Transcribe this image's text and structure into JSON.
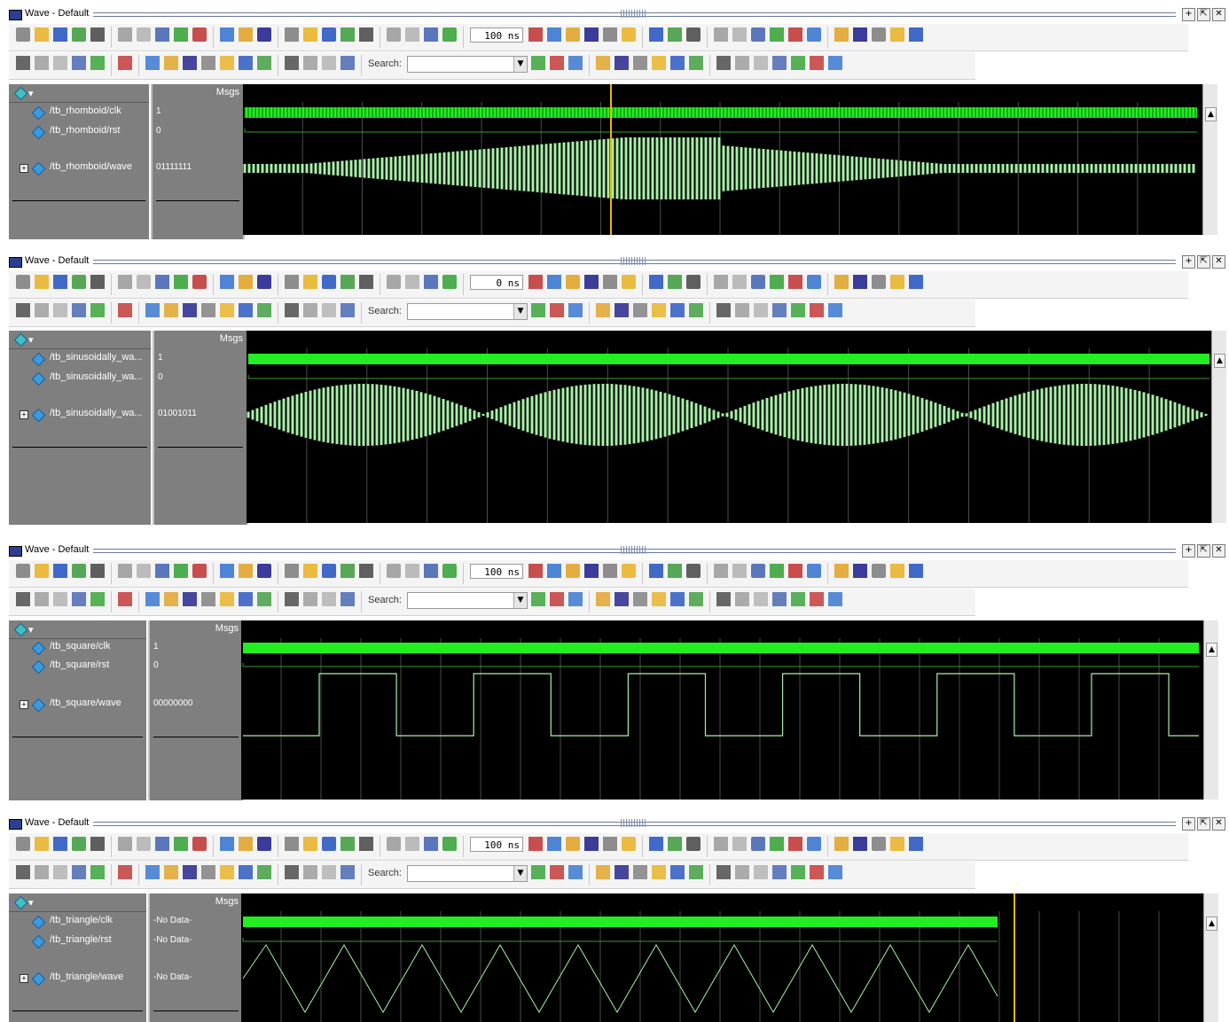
{
  "colors": {
    "wave_green": "#a8f0a8",
    "clk_green": "#22ee22",
    "cursor_yellow": "#f0b400",
    "grid": "#4a4a4a",
    "name_bg": "#7f7f7f"
  },
  "panels": [
    {
      "window_title": "Wave - Default",
      "time_value": "100 ns",
      "search_label": "Search:",
      "msgs_header": "Msgs",
      "signals": [
        {
          "name": "/tb_rhomboid/clk",
          "value": "1",
          "expandable": false
        },
        {
          "name": "/tb_rhomboid/rst",
          "value": "0",
          "expandable": false
        },
        {
          "name": "/tb_rhomboid/wave",
          "value": "01111111",
          "expandable": true
        }
      ],
      "wave_shape": "rhomboid",
      "has_cursor": true
    },
    {
      "window_title": "Wave - Default",
      "time_value": "0 ns",
      "search_label": "Search:",
      "msgs_header": "Msgs",
      "signals": [
        {
          "name": "/tb_sinusoidally_wa...",
          "value": "1",
          "expandable": false
        },
        {
          "name": "/tb_sinusoidally_wa...",
          "value": "0",
          "expandable": false
        },
        {
          "name": "/tb_sinusoidally_wa...",
          "value": "01001011",
          "expandable": true
        }
      ],
      "wave_shape": "sinusoidal",
      "has_cursor": false
    },
    {
      "window_title": "Wave - Default",
      "time_value": "100 ns",
      "search_label": "Search:",
      "msgs_header": "Msgs",
      "signals": [
        {
          "name": "/tb_square/clk",
          "value": "1",
          "expandable": false
        },
        {
          "name": "/tb_square/rst",
          "value": "0",
          "expandable": false
        },
        {
          "name": "/tb_square/wave",
          "value": "00000000",
          "expandable": true
        }
      ],
      "wave_shape": "square",
      "has_cursor": false
    },
    {
      "window_title": "Wave - Default",
      "time_value": "100 ns",
      "search_label": "Search:",
      "msgs_header": "Msgs",
      "signals": [
        {
          "name": "/tb_triangle/clk",
          "value": "-No Data-",
          "expandable": false
        },
        {
          "name": "/tb_triangle/rst",
          "value": "-No Data-",
          "expandable": false
        },
        {
          "name": "/tb_triangle/wave",
          "value": "-No Data-",
          "expandable": true
        }
      ],
      "wave_shape": "triangle",
      "has_cursor": true
    }
  ]
}
